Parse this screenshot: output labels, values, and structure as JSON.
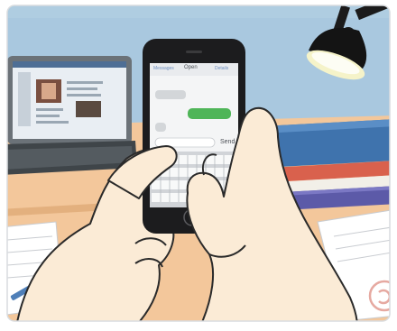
{
  "phone": {
    "header_left": "Messages",
    "header_title": "Open",
    "header_right": "Details",
    "send_label": "Send"
  },
  "colors": {
    "wall": "#a9c8df",
    "desk": "#f3c79b",
    "lamp": "#1b1b1b",
    "bubble_sent": "#4fb558",
    "bubble_received": "#d3d6d9",
    "skin": "#fbebd6",
    "books": "#3f73ad"
  },
  "icons": [
    "desk-lamp-icon",
    "laptop-icon",
    "smartphone-icon",
    "home-button-icon",
    "corner-logo-icon"
  ]
}
